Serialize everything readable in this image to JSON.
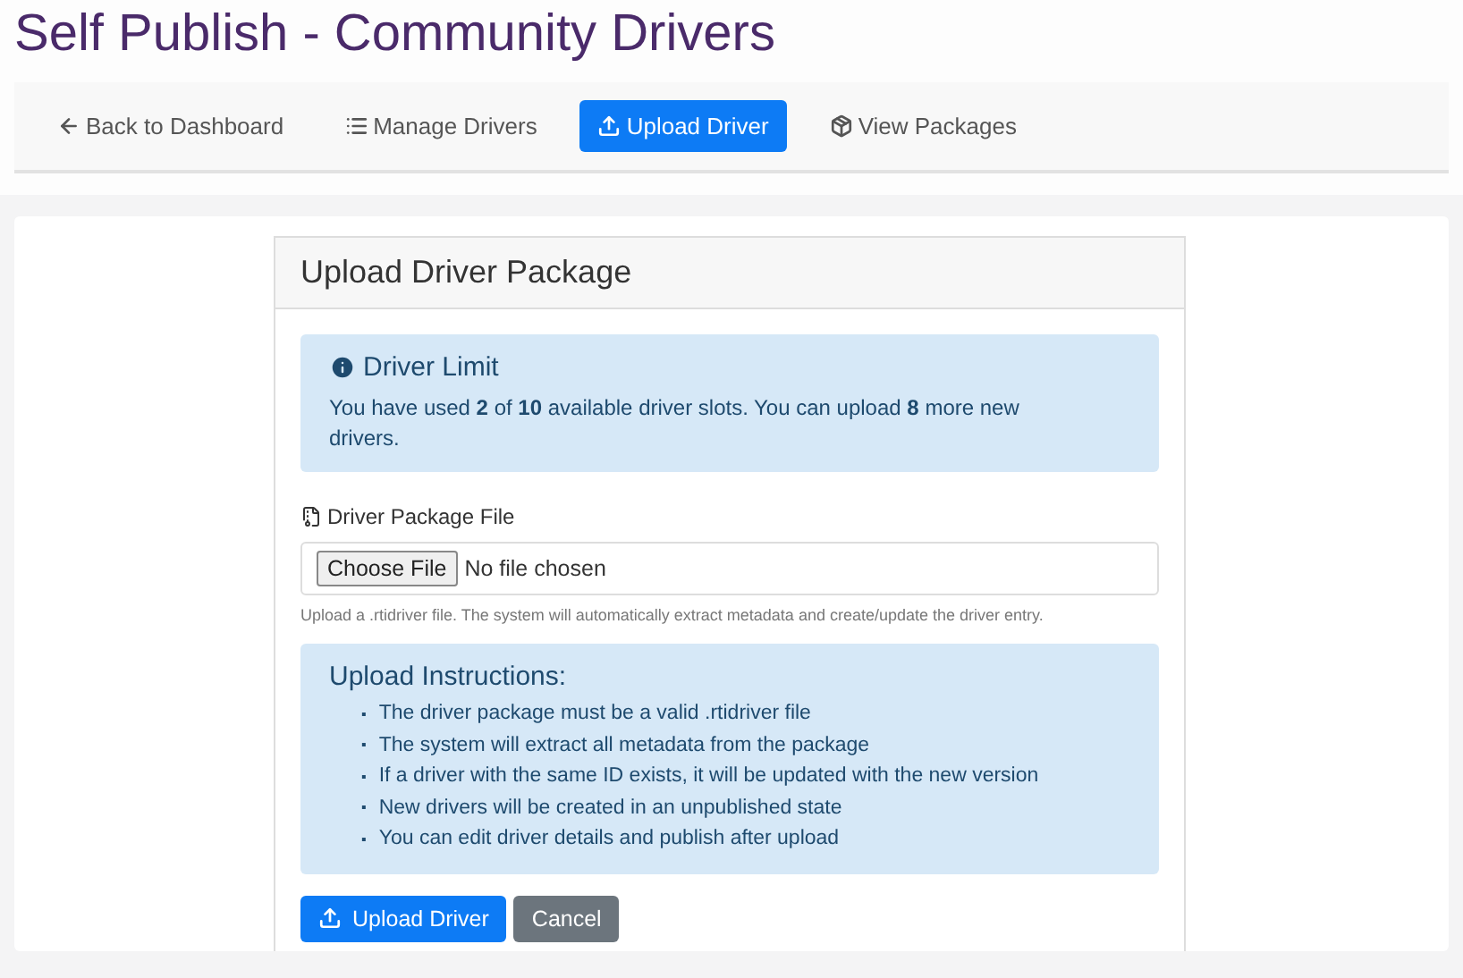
{
  "page_title": "Self Publish - Community Drivers",
  "nav": [
    {
      "label": "Back to Dashboard",
      "selected": false
    },
    {
      "label": "Manage Drivers",
      "selected": false
    },
    {
      "label": "Upload Driver",
      "selected": true
    },
    {
      "label": "View Packages",
      "selected": false
    }
  ],
  "card": {
    "title": "Upload Driver Package",
    "limit_alert": {
      "title": "Driver Limit",
      "text": "You have used **2** of **10** available driver slots. You can upload **8** more new drivers."
    },
    "file_field": {
      "label": "Driver Package File",
      "button": "Choose File",
      "value": "No file chosen",
      "help": "Upload a .rtidriver file. The system will automatically extract metadata and create/update the driver entry."
    },
    "instructions": {
      "title": "Upload Instructions:",
      "bullet": "▪",
      "items": [
        "The driver package must be a valid .rtidriver file",
        "The system will extract all metadata from the package",
        "If a driver with the same ID exists, it will be updated with the new version",
        "New drivers will be created in an unpublished state",
        "You can edit driver details and publish after upload"
      ]
    },
    "buttons": [
      {
        "label": "Upload Driver",
        "kind": "primary"
      },
      {
        "label": "Cancel",
        "kind": "secondary"
      }
    ]
  }
}
